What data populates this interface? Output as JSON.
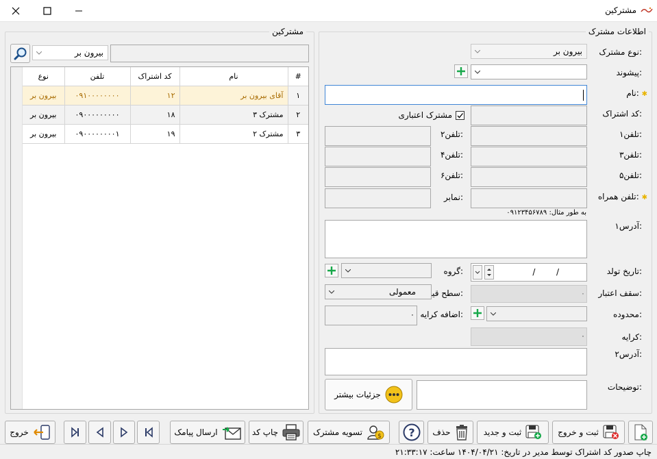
{
  "window": {
    "title": "مشترکین"
  },
  "list_panel": {
    "title": "مشترکین",
    "filter_value": "بیرون بر",
    "columns": {
      "num": "#",
      "name": "نام",
      "code": "کد اشتراک",
      "phone": "تلفن",
      "type": "نوع"
    },
    "rows": [
      {
        "num": "۱",
        "name": "آقای بیرون بر",
        "code": "۱۲",
        "phone": "۰۹۱۰۰۰۰۰۰۰۰",
        "type": "بیرون بر"
      },
      {
        "num": "۲",
        "name": "مشترک ۳",
        "code": "۱۸",
        "phone": "۰۹۰۰۰۰۰۰۰۰۰",
        "type": "بیرون بر"
      },
      {
        "num": "۳",
        "name": "مشترک ۲",
        "code": "۱۹",
        "phone": "۰۹۰۰۰۰۰۰۰۰۱",
        "type": "بیرون بر"
      }
    ]
  },
  "form": {
    "title": "اطلاعات مشترک",
    "customer_type_label": "نوع مشترک:",
    "customer_type_value": "بیرون بر",
    "prefix_label": "پیشوند:",
    "name_label": "نام:",
    "code_label": "کد اشتراک:",
    "credit_customer_label": "مشترک اعتباری",
    "phone1_label": "تلفن۱:",
    "phone2_label": "تلفن۲:",
    "phone3_label": "تلفن۳:",
    "phone4_label": "تلفن۴:",
    "phone5_label": "تلفن۵:",
    "phone6_label": "تلفن۶:",
    "mobile_label": "تلفن همراه:",
    "fax_label": "نمابر:",
    "mobile_example": "به طور مثال: ۰۹۱۲۳۴۵۶۷۸۹",
    "address1_label": "آدرس۱:",
    "birth_date_label": "تاریخ تولد:",
    "birth_date_value": "/        /",
    "group_label": "گروه:",
    "credit_limit_label": "سقف اعتبار:",
    "credit_limit_value": "۰",
    "price_level_label": "سطح قیمت:",
    "price_level_value": "معمولی",
    "area_label": "محدوده:",
    "extra_fare_label": "اضافه کرایه:",
    "extra_fare_value": "۰",
    "fare_label": "کرایه:",
    "fare_value": "۰",
    "address2_label": "آدرس۲:",
    "notes_label": "توضیحات:",
    "more_details_label": "جزئیات بیشتر"
  },
  "toolbar": {
    "save_exit": "ثبت و خروج",
    "save_new": "ثبت و جدید",
    "delete": "حذف",
    "settle": "تسویه مشترک",
    "print_code": "چاپ کد",
    "send_sms": "ارسال پیامک",
    "exit": "خروج"
  },
  "status": {
    "text": "چاپ صدور کد اشتراک توسط مدیر در تاریخ: ۱۴۰۴/۰۴/۲۱ ساعت: ۲۱:۳۳:۱۷"
  },
  "colors": {
    "selected_row": "#fdf3d8",
    "selected_text": "#a86b00",
    "plus_green": "#17a84a"
  }
}
